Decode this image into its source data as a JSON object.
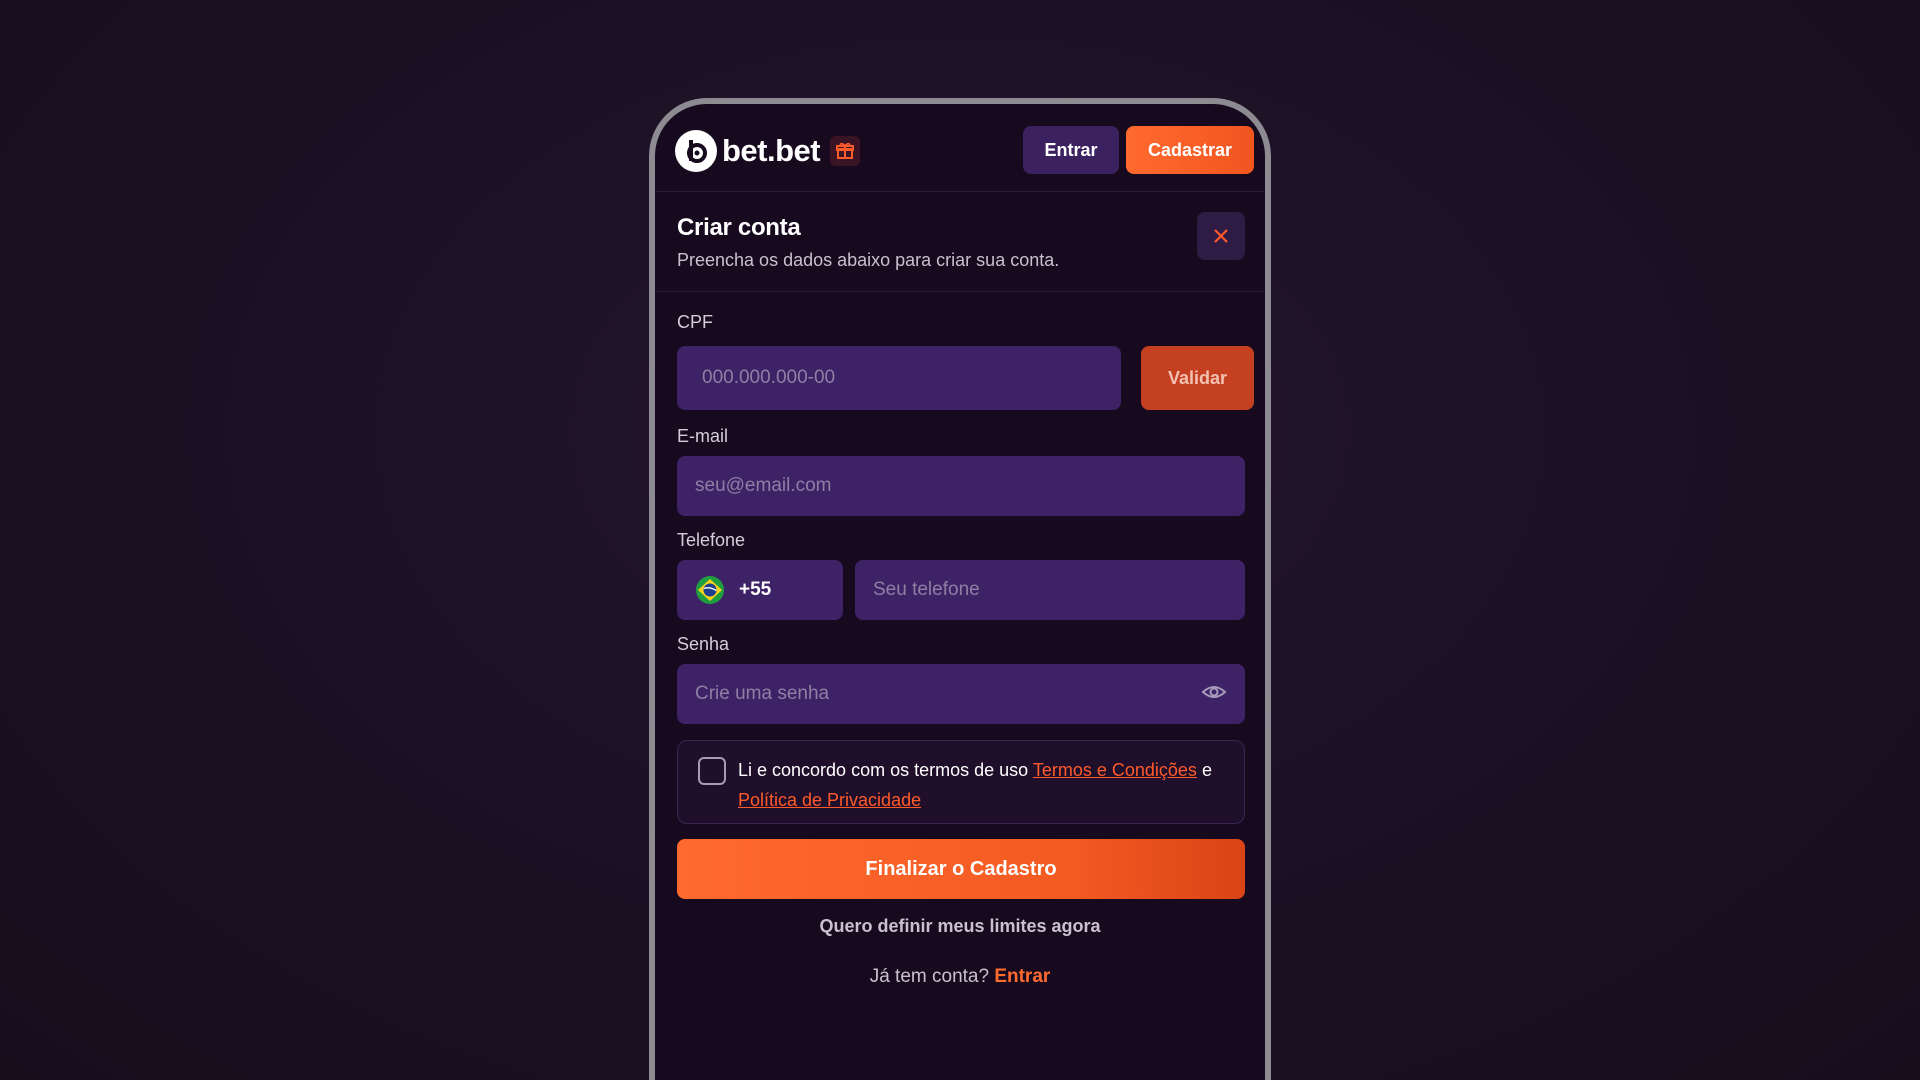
{
  "topbar": {
    "brand": "bet.bet",
    "login_label": "Entrar",
    "signup_label": "Cadastrar"
  },
  "modal": {
    "title": "Criar conta",
    "subtitle": "Preencha os dados abaixo para criar sua conta."
  },
  "form": {
    "cpf": {
      "label": "CPF",
      "placeholder": "000.000.000-00",
      "validate_label": "Validar"
    },
    "email": {
      "label": "E-mail",
      "placeholder": "seu@email.com"
    },
    "phone": {
      "label": "Telefone",
      "country_code": "+55",
      "placeholder": "Seu telefone"
    },
    "password": {
      "label": "Senha",
      "placeholder": "Crie uma senha"
    },
    "terms": {
      "text": "Li e concordo com os termos de uso",
      "terms_link": "Termos e Condições",
      "conjunction": "e",
      "privacy_link": "Política de Privacidade"
    },
    "submit_label": "Finalizar o Cadastro",
    "limits_link": "Quero definir meus limites agora",
    "login_prompt": "Já tem conta?",
    "login_link": "Entrar"
  },
  "icons": {
    "close": "close-icon",
    "gift": "gift-icon",
    "flag": "brazil-flag-icon",
    "eye": "eye-icon"
  },
  "colors": {
    "accent": "#ff6a2e",
    "input_bg": "#3e2266",
    "page_bg": "#170a1f"
  }
}
